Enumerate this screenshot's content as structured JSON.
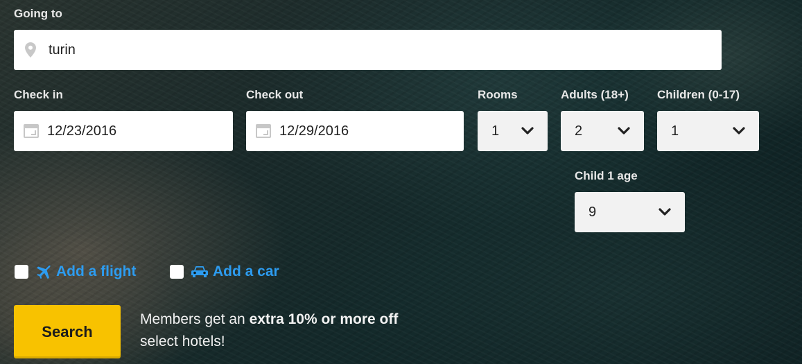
{
  "destination": {
    "label": "Going to",
    "value": "turin",
    "icon": "map-pin-icon"
  },
  "check_in": {
    "label": "Check in",
    "value": "12/23/2016",
    "icon": "calendar-icon"
  },
  "check_out": {
    "label": "Check out",
    "value": "12/29/2016",
    "icon": "calendar-icon"
  },
  "rooms": {
    "label": "Rooms",
    "value": "1"
  },
  "adults": {
    "label": "Adults (18+)",
    "value": "2"
  },
  "children": {
    "label": "Children (0-17)",
    "value": "1"
  },
  "child_age": {
    "label": "Child 1 age",
    "value": "9"
  },
  "addons": {
    "flight": {
      "label": "Add a flight",
      "icon": "airplane-icon",
      "checked": false
    },
    "car": {
      "label": "Add a car",
      "icon": "car-icon",
      "checked": false
    }
  },
  "search_button": {
    "label": "Search"
  },
  "promo": {
    "line1_prefix": "Members get an ",
    "line1_bold": "extra 10% or more off",
    "line2": "select hotels!"
  },
  "colors": {
    "accent_link": "#2d9cf0",
    "search_button": "#f8c200"
  }
}
